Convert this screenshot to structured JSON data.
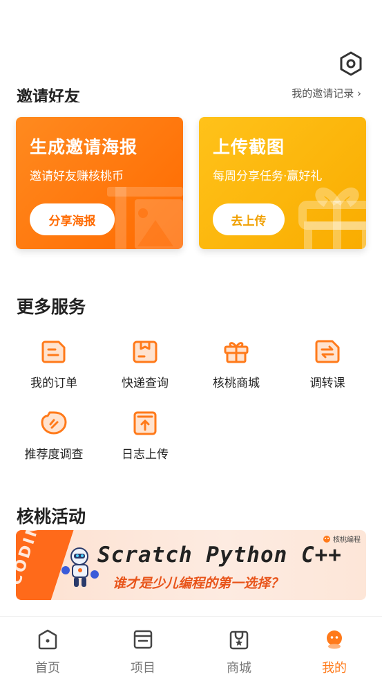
{
  "header": {
    "settings_icon": "hexagon-gear-icon"
  },
  "invite": {
    "title": "邀请好友",
    "records_link": "我的邀请记录 ›"
  },
  "cards": [
    {
      "title": "生成邀请海报",
      "subtitle": "邀请好友赚核桃币",
      "button": "分享海报",
      "color": "#ff6a00",
      "icon": "poster-image-icon"
    },
    {
      "title": "上传截图",
      "subtitle": "每周分享任务·赢好礼",
      "button": "去上传",
      "color": "#f9ac00",
      "icon": "gift-icon"
    }
  ],
  "services": {
    "title": "更多服务",
    "items": [
      {
        "label": "我的订单",
        "icon": "order-icon"
      },
      {
        "label": "快递查询",
        "icon": "package-icon"
      },
      {
        "label": "核桃商城",
        "icon": "gift-icon"
      },
      {
        "label": "调转课",
        "icon": "transfer-icon"
      },
      {
        "label": "推荐度调查",
        "icon": "survey-icon"
      },
      {
        "label": "日志上传",
        "icon": "upload-icon"
      }
    ]
  },
  "activity": {
    "title": "核桃活动",
    "banner": {
      "vertical_text": "CODING",
      "line1": "Scratch Python C++",
      "line2": "谁才是少儿编程的第一选择？",
      "logo_text": "核桃编程"
    }
  },
  "tabbar": {
    "items": [
      {
        "label": "首页",
        "icon": "home-icon",
        "active": false
      },
      {
        "label": "项目",
        "icon": "project-icon",
        "active": false
      },
      {
        "label": "商城",
        "icon": "mall-icon",
        "active": false
      },
      {
        "label": "我的",
        "icon": "profile-mascot-icon",
        "active": true
      }
    ],
    "active_color": "#ff7a1a"
  }
}
